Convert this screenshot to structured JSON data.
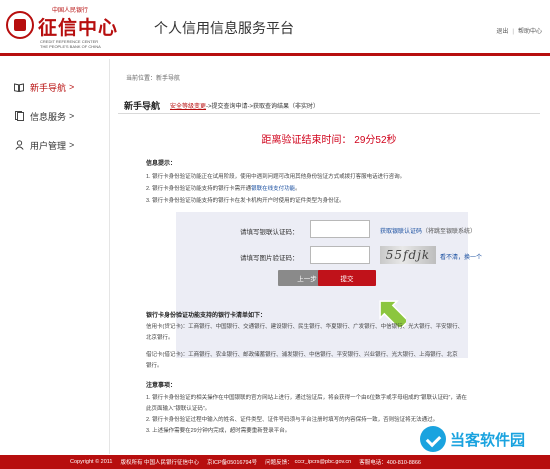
{
  "header": {
    "logo_top": "中国人民银行",
    "logo_cn": "征信中心",
    "logo_en1": "CREDIT REFERENCE CENTER",
    "logo_en2": "THE PEOPLE'S BANK OF CHINA",
    "platform_title": "个人信用信息服务平台",
    "link_logout": "退出",
    "link_help": "帮助中心"
  },
  "sidebar": {
    "items": [
      {
        "label": "新手导航",
        "icon": "book-icon"
      },
      {
        "label": "信息服务",
        "icon": "document-icon"
      },
      {
        "label": "用户管理",
        "icon": "user-icon"
      }
    ],
    "arrow": ">"
  },
  "main": {
    "breadcrumb": "当前位置：新手导航",
    "page_title": "新手导航",
    "steps": {
      "step1": "安全等级变更",
      "step2": "->提交查询申请",
      "step3": "->获取查询结果（非实时）"
    },
    "countdown": "距离验证结束时间：  29分52秒",
    "tips_title": "信息提示：",
    "tips": [
      {
        "text": "1. 银行卡身份验证功能正在试用阶段，使用中遇到问题可改用其他身份验证方式或拨打客服电话进行咨询。"
      },
      {
        "text": "2. 银行卡身份验证功能支持的银行卡需开通",
        "link": "银联在线支付功能",
        "after": "。"
      },
      {
        "text": "3. 银行卡身份验证功能支持的银行卡在发卡机构开户时使用的证件类型为身份证。"
      }
    ],
    "form": {
      "label_unionpay_code": "请填写银联认证码：",
      "link_get_code": "获取银联认证码",
      "hint_code": "（将跳至银联系统）",
      "label_captcha": "请填写图片验证码：",
      "captcha_text": "55fdjk",
      "link_refresh": "看不清，换一个",
      "btn_prev": "上一步",
      "btn_submit": "提交"
    },
    "banks_title": "银行卡身份验证功能支持的银行卡清单如下：",
    "credit_cards": "信用卡(贷记卡)：工商银行、中国银行、交通银行、建设银行、民生银行、华夏银行、广发银行、中信银行、光大银行、平安银行、",
    "credit_cards_2": "北京银行。",
    "debit_cards": "借记卡(借记卡)：工商银行、农业银行、邮政储蓄银行、浦发银行、中信银行、平安银行、兴业银行、光大银行、上海银行、北京",
    "debit_cards_2": "银行。",
    "notes_title": "注意事项：",
    "notes": [
      "1. 银行卡身份验证的相关操作在中国银联的官方网站上进行，通过验证后，将会获得一个由6位数字或字母组成的“银联认证码”，请在",
      "此页面输入“银联认证码”。",
      "2. 银行卡身份验证过程中输入的姓名、证件类型、证件号码须与平台注册时填写的内容保持一致，否则验证将无法通过。",
      "3. 上述操作需要在29分钟内完成，超时需要重新登录平台。"
    ]
  },
  "footer": {
    "copyright": "Copyright © 2011",
    "rights": "版权所有 中国人民银行征信中心",
    "icp": "京ICP备05016794号",
    "feedback_label": "问题反馈：",
    "feedback_email": "cccr_ipcrs@pbc.gov.cn",
    "hotline": "客服电话：400-810-8866"
  },
  "watermark": "当客软件园",
  "colors": {
    "brand_red": "#b70e0e",
    "countdown_red": "#d0021b",
    "link_blue": "#1a4fa0",
    "form_bg": "#ecedf5",
    "arrow_green": "#8cc63f"
  }
}
